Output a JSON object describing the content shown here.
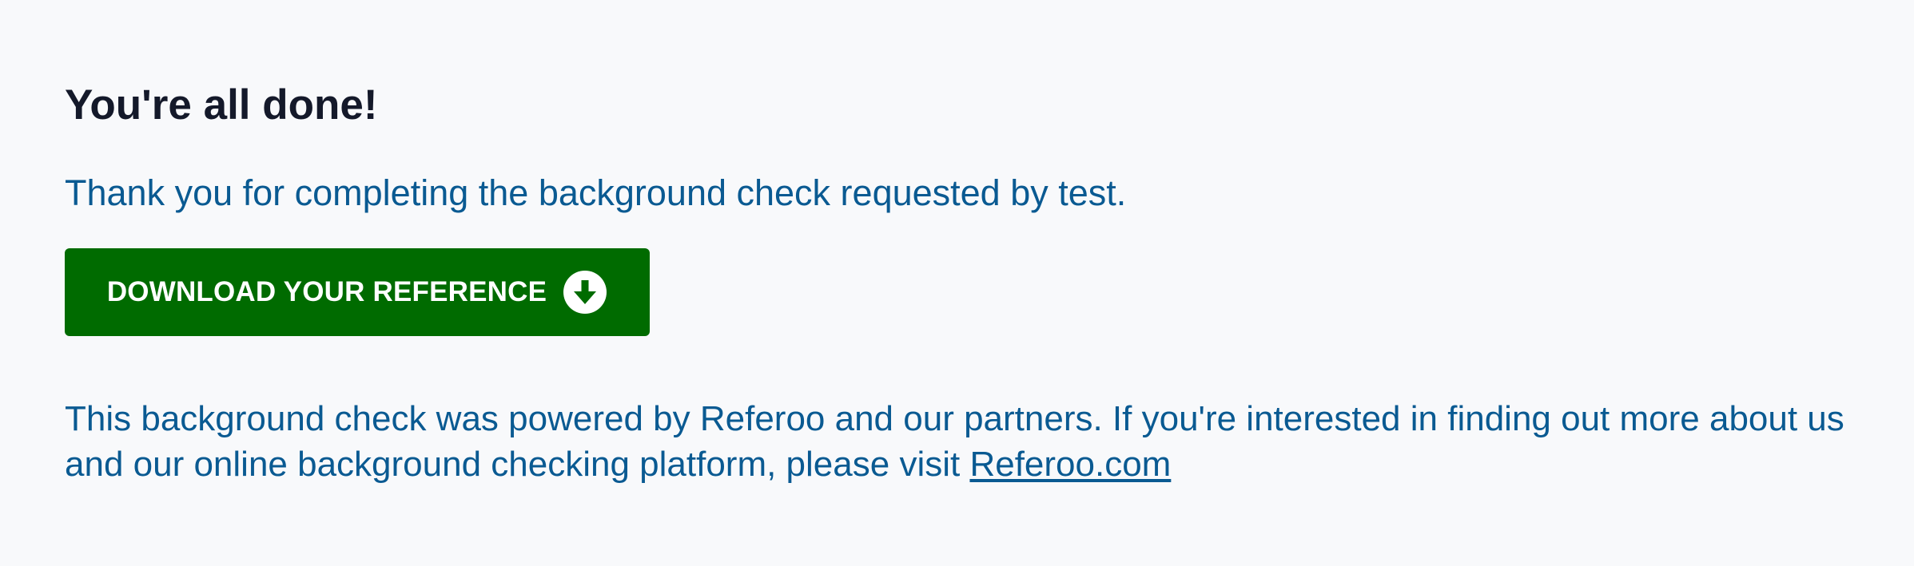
{
  "main": {
    "heading": "You're all done!",
    "thanks_text": "Thank you for completing the background check requested by test.",
    "download_button_label": "DOWNLOAD YOUR REFERENCE",
    "download_icon": "arrow-down-circle-icon",
    "powered_text": "This background check was powered by Referoo and our partners. If you're interested in finding out more about us and our online background checking platform, please visit ",
    "referoo_link_text": "Referoo.com"
  },
  "colors": {
    "background": "#f8f9fb",
    "heading": "#14192a",
    "body_text": "#0a5a92",
    "button_bg": "#006b00",
    "button_text": "#ffffff"
  }
}
